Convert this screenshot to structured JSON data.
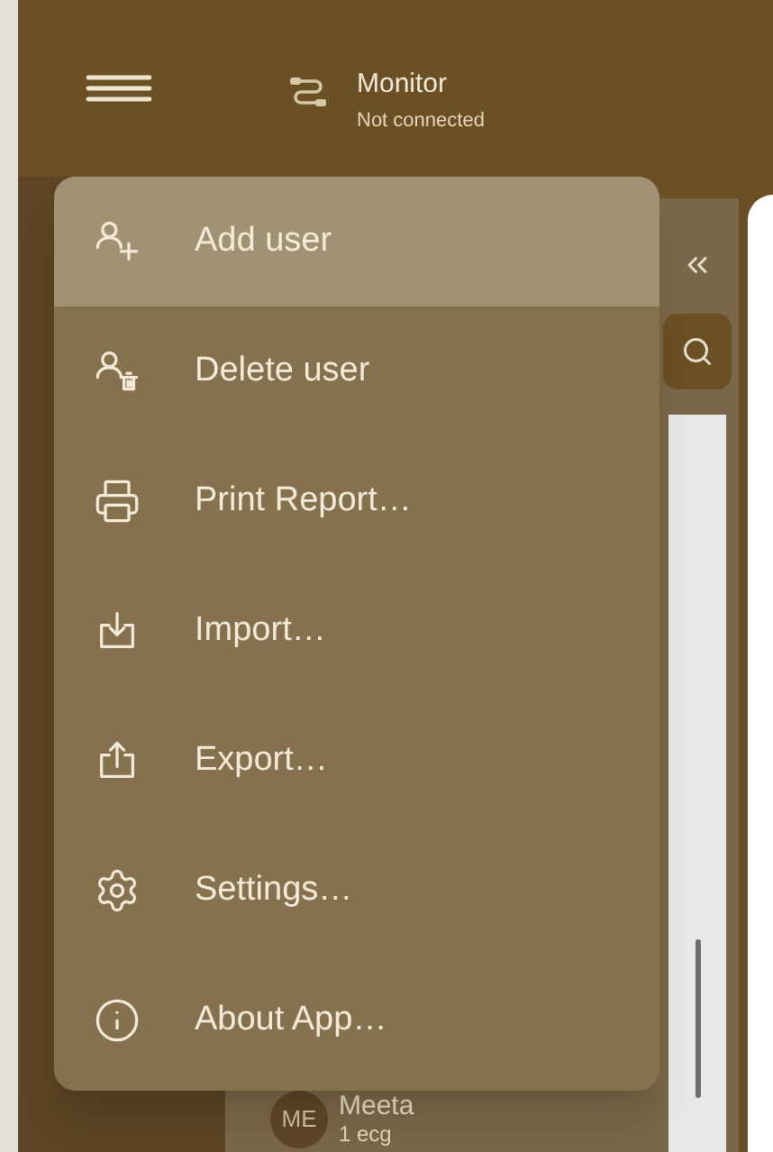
{
  "header": {
    "title": "Monitor",
    "status": "Not connected"
  },
  "menu": {
    "items": [
      {
        "label": "Add user",
        "kind": "add-user",
        "selected": true
      },
      {
        "label": "Delete user",
        "kind": "delete-user",
        "selected": false
      },
      {
        "label": "Print Report…",
        "kind": "print",
        "selected": false
      },
      {
        "label": "Import…",
        "kind": "import",
        "selected": false
      },
      {
        "label": "Export…",
        "kind": "export",
        "selected": false
      },
      {
        "label": "Settings…",
        "kind": "settings",
        "selected": false
      },
      {
        "label": "About App…",
        "kind": "about",
        "selected": false
      }
    ]
  },
  "user_list": {
    "items": [
      {
        "initials": "ME",
        "name": "Meeta",
        "detail": "1 ecg"
      }
    ]
  }
}
